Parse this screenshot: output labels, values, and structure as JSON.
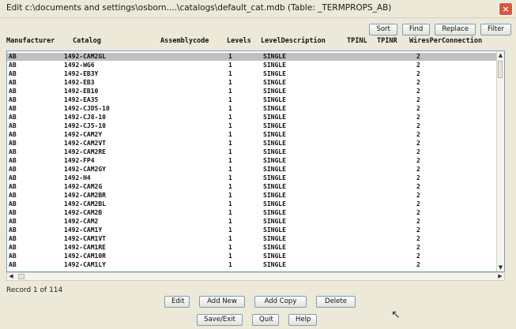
{
  "window": {
    "title": "Edit c:\\documents and settings\\osborn....\\catalogs\\default_cat.mdb (Table: _TERMPROPS_AB)",
    "close_label": "×"
  },
  "toolbar": {
    "sort": "Sort",
    "find": "Find",
    "replace": "Replace",
    "filter": "Filter"
  },
  "columns": [
    "Manufacturer",
    "Catalog",
    "Assemblycode",
    "Levels",
    "LevelDescription",
    "TPINL",
    "TPINR",
    "WiresPerConnection"
  ],
  "rows": [
    {
      "manufacturer": "AB",
      "catalog": "1492-CAM2GL",
      "levels": "1",
      "desc": "SINGLE",
      "wires": "2"
    },
    {
      "manufacturer": "AB",
      "catalog": "1492-WG6",
      "levels": "1",
      "desc": "SINGLE",
      "wires": "2"
    },
    {
      "manufacturer": "AB",
      "catalog": "1492-EB3Y",
      "levels": "1",
      "desc": "SINGLE",
      "wires": "2"
    },
    {
      "manufacturer": "AB",
      "catalog": "1492-EB3",
      "levels": "1",
      "desc": "SINGLE",
      "wires": "2"
    },
    {
      "manufacturer": "AB",
      "catalog": "1492-EB10",
      "levels": "1",
      "desc": "SINGLE",
      "wires": "2"
    },
    {
      "manufacturer": "AB",
      "catalog": "1492-EA35",
      "levels": "1",
      "desc": "SINGLE",
      "wires": "2"
    },
    {
      "manufacturer": "AB",
      "catalog": "1492-CJD5-10",
      "levels": "1",
      "desc": "SINGLE",
      "wires": "2"
    },
    {
      "manufacturer": "AB",
      "catalog": "1492-CJ8-10",
      "levels": "1",
      "desc": "SINGLE",
      "wires": "2"
    },
    {
      "manufacturer": "AB",
      "catalog": "1492-CJ5-10",
      "levels": "1",
      "desc": "SINGLE",
      "wires": "2"
    },
    {
      "manufacturer": "AB",
      "catalog": "1492-CAM2Y",
      "levels": "1",
      "desc": "SINGLE",
      "wires": "2"
    },
    {
      "manufacturer": "AB",
      "catalog": "1492-CAM2VT",
      "levels": "1",
      "desc": "SINGLE",
      "wires": "2"
    },
    {
      "manufacturer": "AB",
      "catalog": "1492-CAM2RE",
      "levels": "1",
      "desc": "SINGLE",
      "wires": "2"
    },
    {
      "manufacturer": "AB",
      "catalog": "1492-FP4",
      "levels": "1",
      "desc": "SINGLE",
      "wires": "2"
    },
    {
      "manufacturer": "AB",
      "catalog": "1492-CAM2GY",
      "levels": "1",
      "desc": "SINGLE",
      "wires": "2"
    },
    {
      "manufacturer": "AB",
      "catalog": "1492-H4",
      "levels": "1",
      "desc": "SINGLE",
      "wires": "2"
    },
    {
      "manufacturer": "AB",
      "catalog": "1492-CAM2G",
      "levels": "1",
      "desc": "SINGLE",
      "wires": "2"
    },
    {
      "manufacturer": "AB",
      "catalog": "1492-CAM2BR",
      "levels": "1",
      "desc": "SINGLE",
      "wires": "2"
    },
    {
      "manufacturer": "AB",
      "catalog": "1492-CAM2BL",
      "levels": "1",
      "desc": "SINGLE",
      "wires": "2"
    },
    {
      "manufacturer": "AB",
      "catalog": "1492-CAM2B",
      "levels": "1",
      "desc": "SINGLE",
      "wires": "2"
    },
    {
      "manufacturer": "AB",
      "catalog": "1492-CAM2",
      "levels": "1",
      "desc": "SINGLE",
      "wires": "2"
    },
    {
      "manufacturer": "AB",
      "catalog": "1492-CAM1Y",
      "levels": "1",
      "desc": "SINGLE",
      "wires": "2"
    },
    {
      "manufacturer": "AB",
      "catalog": "1492-CAM1VT",
      "levels": "1",
      "desc": "SINGLE",
      "wires": "2"
    },
    {
      "manufacturer": "AB",
      "catalog": "1492-CAM1RE",
      "levels": "1",
      "desc": "SINGLE",
      "wires": "2"
    },
    {
      "manufacturer": "AB",
      "catalog": "1492-CAM10R",
      "levels": "1",
      "desc": "SINGLE",
      "wires": "2"
    },
    {
      "manufacturer": "AB",
      "catalog": "1492-CAM1LY",
      "levels": "1",
      "desc": "SINGLE",
      "wires": "2"
    }
  ],
  "status": {
    "record": "Record 1 of 114"
  },
  "buttons": {
    "edit": "Edit",
    "add_new": "Add New",
    "add_copy": "Add Copy",
    "delete": "Delete",
    "save_exit": "Save/Exit",
    "quit": "Quit",
    "help": "Help"
  },
  "scroll_glyphs": {
    "up": "▲",
    "down": "▼",
    "left": "◀",
    "right": "▶"
  },
  "cursor_glyph": "↖",
  "colors": {
    "selected_row": "#c0c0c0",
    "close_button": "#d9573e",
    "border": "#7f9db9"
  }
}
